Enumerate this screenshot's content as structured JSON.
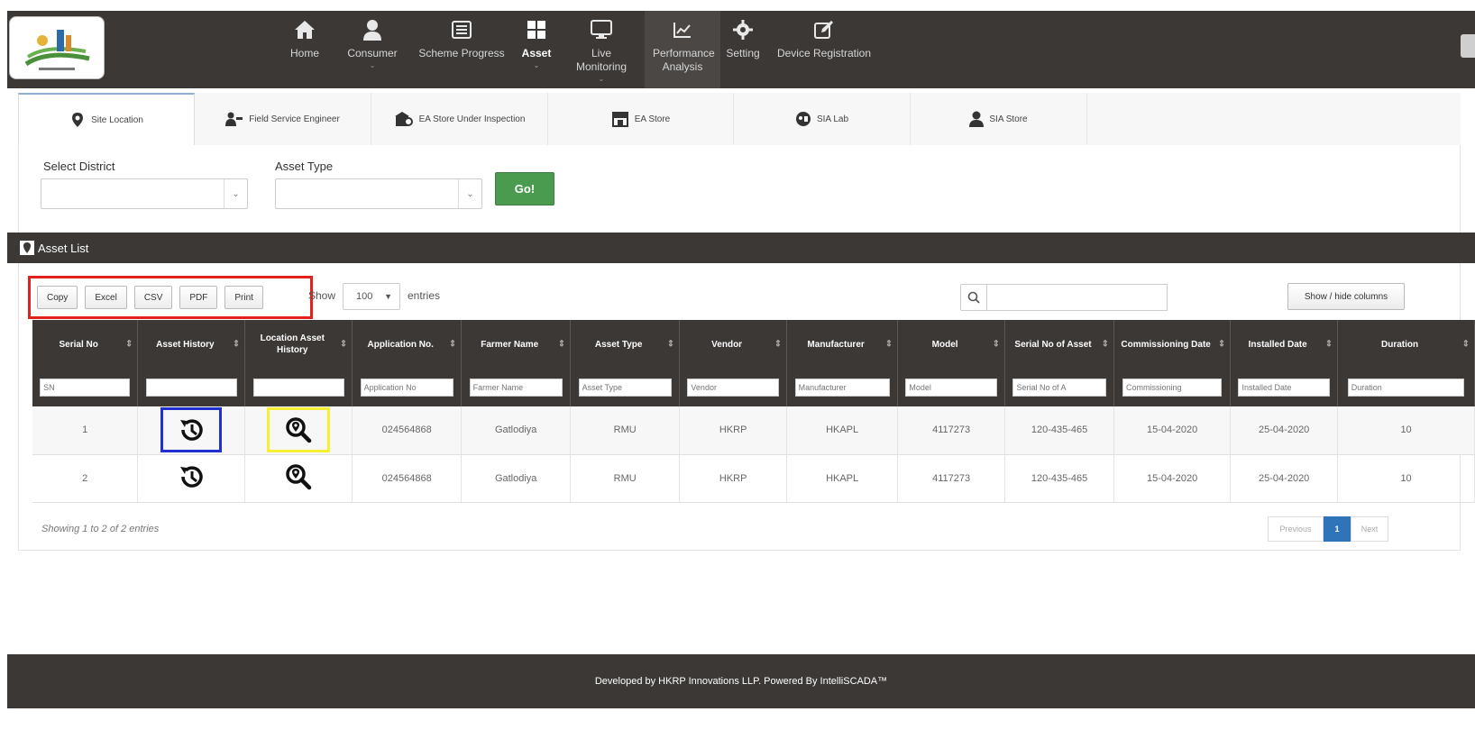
{
  "nav": {
    "items": [
      {
        "label": "Home",
        "icon": "home-icon"
      },
      {
        "label": "Consumer",
        "icon": "user-icon",
        "caret": "⌄"
      },
      {
        "label": "Scheme Progress",
        "icon": "list-icon"
      },
      {
        "label": "Asset",
        "icon": "grid-icon",
        "caret": "⌄",
        "active": true
      },
      {
        "label": "Live Monitoring",
        "icon": "monitor-icon",
        "caret": "⌄"
      },
      {
        "label": "Performance Analysis",
        "icon": "chart-icon"
      },
      {
        "label": "Setting",
        "icon": "gear-icon"
      },
      {
        "label": "Device Registration",
        "icon": "edit-icon"
      }
    ]
  },
  "tabs": [
    {
      "label": "Site Location",
      "icon": "map-marker-icon"
    },
    {
      "label": "Field Service Engineer",
      "icon": "engineer-icon"
    },
    {
      "label": "EA Store Under Inspection",
      "icon": "inspection-icon"
    },
    {
      "label": "EA Store",
      "icon": "store-icon"
    },
    {
      "label": "SIA Lab",
      "icon": "lab-icon"
    },
    {
      "label": "SIA Store",
      "icon": "user-icon"
    }
  ],
  "filters": {
    "district_label": "Select District",
    "asset_type_label": "Asset Type",
    "go_label": "Go!"
  },
  "list": {
    "title": "Asset List",
    "buttons": [
      "Copy",
      "Excel",
      "CSV",
      "PDF",
      "Print"
    ],
    "show_label": "Show",
    "entries_value": "100",
    "entries_label": "entries",
    "show_hide_label": "Show / hide columns"
  },
  "table": {
    "headers": [
      "Serial No",
      "Asset History",
      "Location Asset History",
      "Application No.",
      "Farmer Name",
      "Asset Type",
      "Vendor",
      "Manufacturer",
      "Model",
      "Serial No of Asset",
      "Commissioning Date",
      "Installed Date",
      "Duration"
    ],
    "filters": [
      "SN",
      "",
      "",
      "Application No",
      "Farmer Name",
      "Asset Type",
      "Vendor",
      "Manufacturer",
      "Model",
      "Serial No of A",
      "Commissioning",
      "Installed Date",
      "Duration"
    ],
    "rows": [
      {
        "sn": "1",
        "app_no": "024564868",
        "farmer": "Gatlodiya",
        "type": "RMU",
        "vendor": "HKRP",
        "manufacturer": "HKAPL",
        "model": "4117273",
        "serial": "120-435-465",
        "commissioning": "15-04-2020",
        "installed": "25-04-2020",
        "duration": "10"
      },
      {
        "sn": "2",
        "app_no": "024564868",
        "farmer": "Gatlodiya",
        "type": "RMU",
        "vendor": "HKRP",
        "manufacturer": "HKAPL",
        "model": "4117273",
        "serial": "120-435-465",
        "commissioning": "15-04-2020",
        "installed": "25-04-2020",
        "duration": "10"
      }
    ]
  },
  "info": "Showing 1 to 2 of 2 entries",
  "pager": {
    "previous": "Previous",
    "current": "1",
    "next": "Next"
  },
  "footer": "Developed by HKRP Innovations LLP. Powered By IntelliSCADA™",
  "colors": {
    "dark": "#3b3836",
    "go": "#4a9a4f",
    "page_active": "#2f73b8",
    "highlight_red": "#e2201d",
    "highlight_blue": "#1f2fd0",
    "highlight_yellow": "#f6f034"
  }
}
